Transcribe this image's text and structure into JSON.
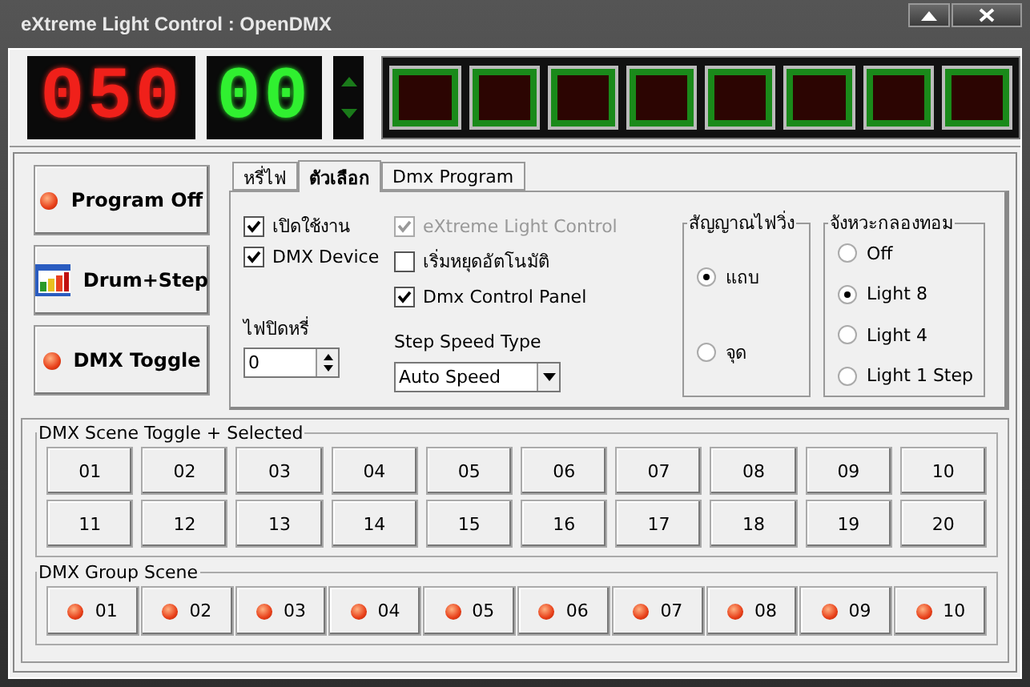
{
  "window": {
    "title": "eXtreme Light Control  :  OpenDMX"
  },
  "displays": {
    "red": "050",
    "green": "00"
  },
  "lamps": [
    {
      "on": false
    },
    {
      "on": false
    },
    {
      "on": false
    },
    {
      "on": false
    },
    {
      "on": false
    },
    {
      "on": false
    },
    {
      "on": false
    },
    {
      "on": false
    }
  ],
  "side_buttons": [
    {
      "label": "Program Off",
      "kind": "led"
    },
    {
      "label": "Drum+Step",
      "kind": "icon"
    },
    {
      "label": "DMX Toggle",
      "kind": "led"
    }
  ],
  "tabs": [
    {
      "label": "หรี่ไฟ",
      "selected": false
    },
    {
      "label": "ตัวเลือก",
      "selected": true
    },
    {
      "label": "Dmx Program",
      "selected": false
    }
  ],
  "options": {
    "column_1": [
      {
        "label": "เปิดใช้งาน",
        "checked": true,
        "disabled": false
      },
      {
        "label": "DMX Device",
        "checked": true,
        "disabled": false
      }
    ],
    "column_2": [
      {
        "label": "eXtreme Light Control",
        "checked": true,
        "disabled": true
      },
      {
        "label": "เริ่มหยุดอัตโนมัติ",
        "checked": false,
        "disabled": false
      },
      {
        "label": "Dmx Control Panel",
        "checked": true,
        "disabled": false
      }
    ],
    "dim_label": "ไฟปิดหรี่",
    "dim_value": "0",
    "speed_label": "Step Speed Type",
    "speed_value": "Auto Speed"
  },
  "signal_group": {
    "title": "สัญญาณไฟวิ่ง",
    "radios": [
      {
        "label": "แถบ",
        "selected": true
      },
      {
        "label": "จุด",
        "selected": false
      }
    ]
  },
  "drum_group": {
    "title": "จังหวะกลองทอม",
    "radios": [
      {
        "label": "Off",
        "selected": false
      },
      {
        "label": "Light 8",
        "selected": true
      },
      {
        "label": "Light 4",
        "selected": false
      },
      {
        "label": "Light 1 Step",
        "selected": false
      }
    ]
  },
  "scene_toggle": {
    "title": "DMX Scene Toggle + Selected",
    "buttons": [
      "01",
      "02",
      "03",
      "04",
      "05",
      "06",
      "07",
      "08",
      "09",
      "10",
      "11",
      "12",
      "13",
      "14",
      "15",
      "16",
      "17",
      "18",
      "19",
      "20"
    ]
  },
  "group_scene": {
    "title": "DMX Group Scene",
    "buttons": [
      "01",
      "02",
      "03",
      "04",
      "05",
      "06",
      "07",
      "08",
      "09",
      "10"
    ]
  }
}
